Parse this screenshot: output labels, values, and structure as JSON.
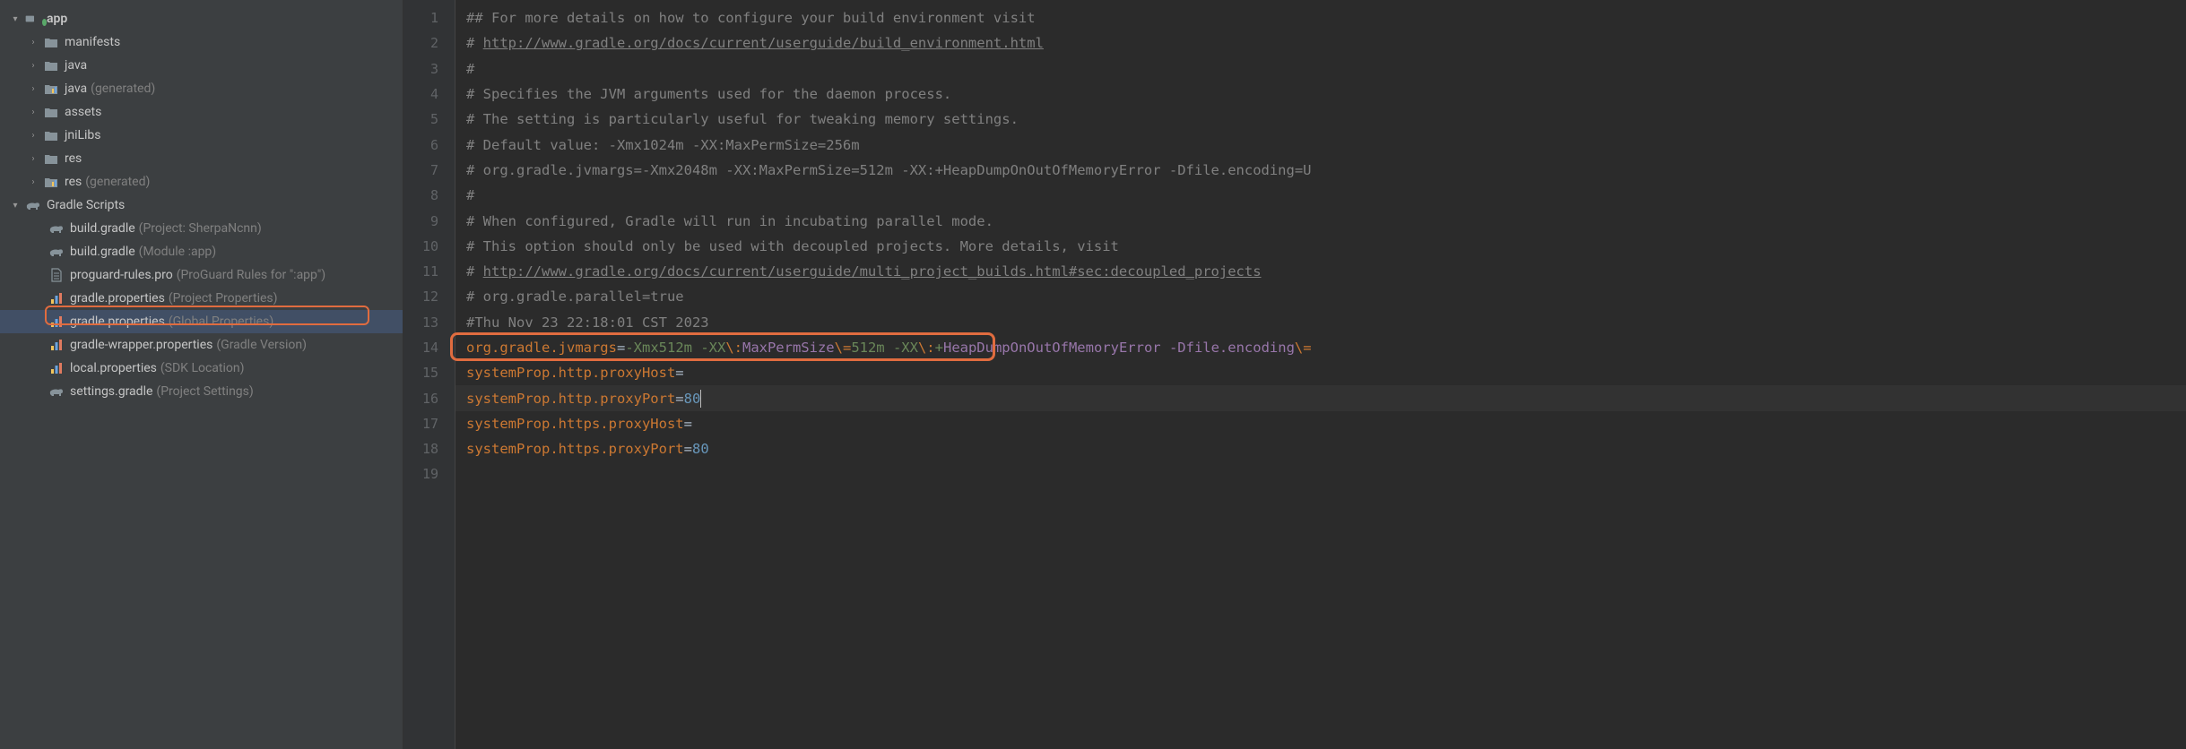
{
  "sidebar": {
    "app": {
      "label": "app"
    },
    "folders": [
      {
        "label": "manifests",
        "note": ""
      },
      {
        "label": "java",
        "note": ""
      },
      {
        "label": "java",
        "note": "(generated)"
      },
      {
        "label": "assets",
        "note": ""
      },
      {
        "label": "jniLibs",
        "note": ""
      },
      {
        "label": "res",
        "note": ""
      },
      {
        "label": "res",
        "note": "(generated)"
      }
    ],
    "gradle_scripts_label": "Gradle Scripts",
    "gradle_items": [
      {
        "label": "build.gradle",
        "note": "(Project: SherpaNcnn)",
        "icon": "gradle"
      },
      {
        "label": "build.gradle",
        "note": "(Module :app)",
        "icon": "gradle"
      },
      {
        "label": "proguard-rules.pro",
        "note": "(ProGuard Rules for \":app\")",
        "icon": "file"
      },
      {
        "label": "gradle.properties",
        "note": "(Project Properties)",
        "icon": "props"
      },
      {
        "label": "gradle.properties",
        "note": "(Global Properties)",
        "icon": "props"
      },
      {
        "label": "gradle-wrapper.properties",
        "note": "(Gradle Version)",
        "icon": "props"
      },
      {
        "label": "local.properties",
        "note": "(SDK Location)",
        "icon": "props"
      },
      {
        "label": "settings.gradle",
        "note": "(Project Settings)",
        "icon": "gradle"
      }
    ]
  },
  "editor": {
    "line_count": 19,
    "lines": {
      "l1": "## For more details on how to configure your build environment visit",
      "l2a": "# ",
      "l2b": "http://www.gradle.org/docs/current/userguide/build_environment.html",
      "l3": "#",
      "l4": "# Specifies the JVM arguments used for the daemon process.",
      "l5": "# The setting is particularly useful for tweaking memory settings.",
      "l6": "# Default value: -Xmx1024m -XX:MaxPermSize=256m",
      "l7": "# org.gradle.jvmargs=-Xmx2048m -XX:MaxPermSize=512m -XX:+HeapDumpOnOutOfMemoryError -Dfile.encoding=U",
      "l8": "#",
      "l9": "# When configured, Gradle will run in incubating parallel mode.",
      "l10": "# This option should only be used with decoupled projects. More details, visit",
      "l11a": "# ",
      "l11b": "http://www.gradle.org/docs/current/userguide/multi_project_builds.html#sec:decoupled_projects",
      "l12": "# org.gradle.parallel=true",
      "l13": "#Thu Nov 23 22:18:01 CST 2023",
      "l14_key": "org.gradle.jvmargs",
      "l14_v1": "-Xmx512m -XX",
      "l14_e1": "\\:",
      "l14_v2": "MaxPermSize",
      "l14_e2": "\\=",
      "l14_v3": "512m -XX",
      "l14_e3": "\\:",
      "l14_v4": "+",
      "l14_v5": "HeapDumpOnOutOfMemoryError -Dfile.encoding",
      "l14_e4": "\\=",
      "l15_key": "systemProp.http.proxyHost",
      "l16_key": "systemProp.http.proxyPort",
      "l16_val": "80",
      "l17_key": "systemProp.https.proxyHost",
      "l18_key": "systemProp.https.proxyPort",
      "l18_val": "80"
    }
  }
}
